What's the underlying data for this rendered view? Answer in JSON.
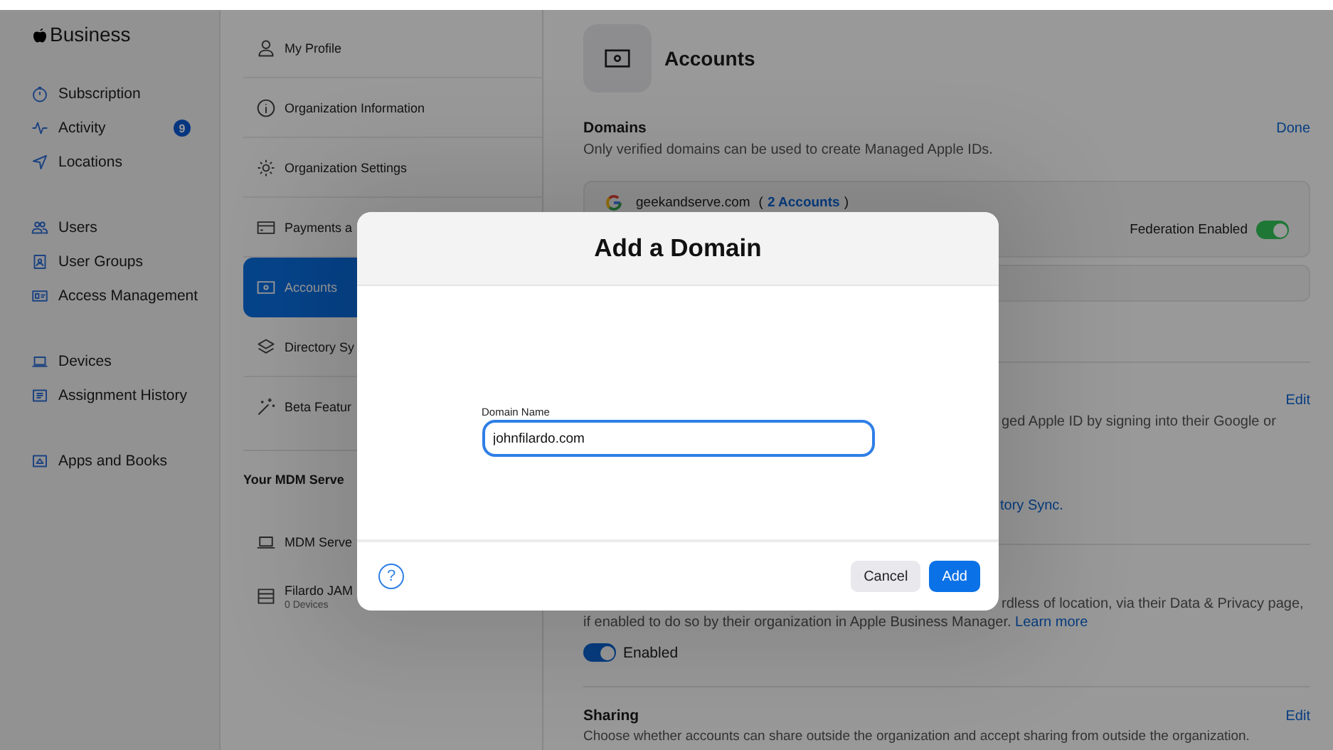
{
  "sidebar": {
    "logo": "Business",
    "groups": [
      {
        "items": [
          {
            "label": "Subscription"
          },
          {
            "label": "Activity",
            "badge": "9"
          },
          {
            "label": "Locations"
          }
        ]
      },
      {
        "items": [
          {
            "label": "Users"
          },
          {
            "label": "User Groups"
          },
          {
            "label": "Access Management"
          }
        ]
      },
      {
        "items": [
          {
            "label": "Devices"
          },
          {
            "label": "Assignment History"
          }
        ]
      },
      {
        "items": [
          {
            "label": "Apps and Books"
          }
        ]
      }
    ]
  },
  "settings_nav": {
    "items": [
      {
        "label": "My Profile",
        "selected": false
      },
      {
        "label": "Organization Information",
        "selected": false
      },
      {
        "label": "Organization Settings",
        "selected": false
      },
      {
        "label": "Payments a",
        "selected": false
      },
      {
        "label": "Accounts",
        "selected": true
      },
      {
        "label": "Directory Sy",
        "selected": false
      },
      {
        "label": "Beta Featur",
        "selected": false
      }
    ],
    "servers_title": "Your MDM Serve",
    "servers": [
      {
        "label": "MDM Serve"
      },
      {
        "label": "Filardo JAM",
        "detail": "0 Devices"
      }
    ]
  },
  "main": {
    "title": "Accounts",
    "domains": {
      "title": "Domains",
      "action": "Done",
      "description": "Only verified domains can be used to create Managed Apple IDs.",
      "domain": {
        "name": "geekandserve.com",
        "accounts_open": "(",
        "accounts_link": "2 Accounts",
        "accounts_close": ")",
        "federation_label": "Federation Enabled",
        "federation_on": true
      }
    },
    "sign_in": {
      "action": "Edit",
      "text": "ged Apple ID by signing into their Google or",
      "link": "tory Sync."
    },
    "data_privacy": {
      "text_tail": "rdless of location, via their Data & Privacy page,",
      "text": "if enabled to do so by their organization in Apple Business Manager.",
      "link": "Learn more",
      "toggle_label": "Enabled",
      "on": true
    },
    "sharing": {
      "title": "Sharing",
      "action": "Edit",
      "description": "Choose whether accounts can share outside the organization and accept sharing from outside the organization."
    }
  },
  "dialog": {
    "title": "Add a Domain",
    "field_label": "Domain Name",
    "value": "johnfilardo.com",
    "help": "?",
    "buttons": [
      {
        "label": "Cancel",
        "kind": "secondary"
      },
      {
        "label": "Add",
        "kind": "primary"
      }
    ]
  }
}
